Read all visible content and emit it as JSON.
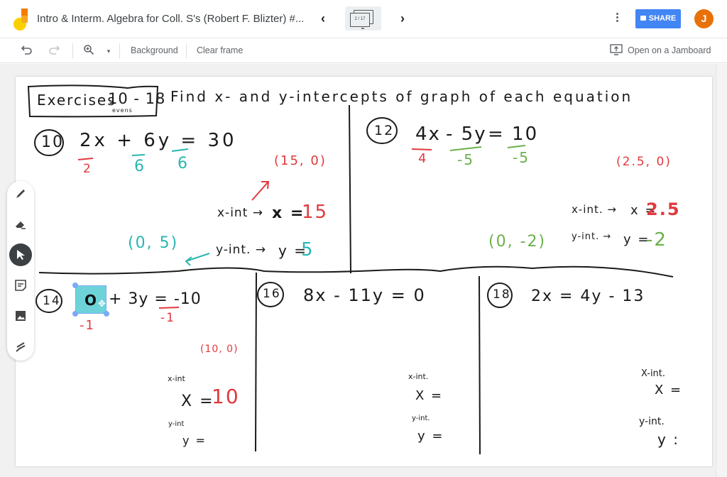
{
  "app": {
    "title": "Intro & Interm. Algebra for Coll. S's (Robert F. Blizter) #...",
    "frame_indicator": "2 / 17",
    "prev_label": "‹",
    "next_label": "›",
    "share_label": "SHARE",
    "avatar_initial": "J",
    "brand_colors": {
      "logo_orange": "#f57c00",
      "logo_yellow": "#fbd000",
      "share_blue": "#4285f4",
      "avatar_orange": "#e8710a"
    }
  },
  "toolbar": {
    "undo_icon": "undo-icon",
    "redo_icon": "redo-icon",
    "zoom_icon": "zoom-icon",
    "zoom_dropdown": "▾",
    "background_label": "Background",
    "clear_frame_label": "Clear frame",
    "open_on_jamboard_label": "Open on a Jamboard"
  },
  "sidebar": {
    "tools": [
      {
        "name": "pen",
        "icon": "pen-icon",
        "active": false
      },
      {
        "name": "eraser",
        "icon": "eraser-icon",
        "active": false
      },
      {
        "name": "select",
        "icon": "select-icon",
        "active": true
      },
      {
        "name": "sticky-note",
        "icon": "sticky-note-icon",
        "active": false
      },
      {
        "name": "image",
        "icon": "image-icon",
        "active": false
      },
      {
        "name": "laser",
        "icon": "laser-icon",
        "active": false
      }
    ]
  },
  "board": {
    "header": {
      "exercises_label": "Exercises",
      "range": "10 - 18",
      "range_note": "evens",
      "instruction": "Find  x-  and  y-intercepts  of  graph  of  each  equation"
    },
    "problems": [
      {
        "number": "10",
        "equation": "2x + 6y = 30",
        "divisors": [
          "2",
          "6",
          "6"
        ],
        "x_point": "(15, 0)",
        "x_int_label": "x-int →",
        "x_int_var": "x =",
        "x_int_value": "15",
        "y_point": "(0, 5)",
        "y_int_label": "y-int. →",
        "y_int_var": "y =",
        "y_int_value": "5"
      },
      {
        "number": "12",
        "equation_parts": [
          "4x",
          "- 5y",
          "= 10"
        ],
        "divisors": [
          "4",
          "-5",
          "-5"
        ],
        "x_point": "(2.5, 0)",
        "x_int_label": "x-int. →",
        "x_int_var": "x =",
        "x_int_value": "2.5",
        "y_point": "(0, -2)",
        "y_int_label": "y-int. →",
        "y_int_var": "y =",
        "y_int_value": "-2"
      },
      {
        "number": "14",
        "selected_text": "O",
        "equation_rest": "+ 3y = -10",
        "divisors": [
          "-1",
          "-1"
        ],
        "x_point": "(10, 0)",
        "x_int_label": "x-int",
        "x_int_var": "X =",
        "x_int_value": "10",
        "y_int_label": "y-int",
        "y_int_var": "y ="
      },
      {
        "number": "16",
        "equation": "8x - 11y = 0",
        "x_int_label": "x-int.",
        "x_int_var": "X =",
        "y_int_label": "y-int.",
        "y_int_var": "y ="
      },
      {
        "number": "18",
        "equation": "2x = 4y - 13",
        "x_int_label": "X-int.",
        "x_int_var": "X =",
        "y_int_label": "y-int.",
        "y_int_var": "y :"
      }
    ]
  }
}
